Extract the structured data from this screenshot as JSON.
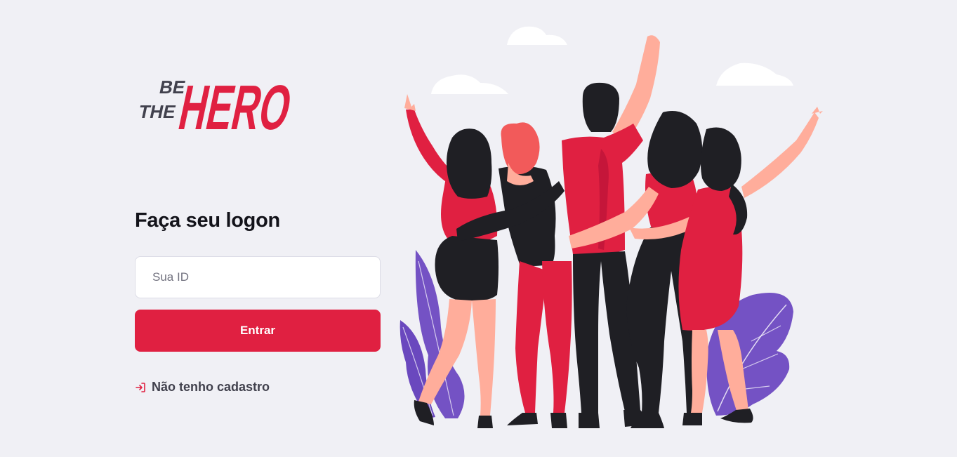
{
  "logo": {
    "top_word": "BE",
    "middle_word": "THE",
    "main_word": "HERO"
  },
  "form": {
    "title": "Faça seu logon",
    "id_placeholder": "Sua ID",
    "id_value": "",
    "submit_label": "Entrar",
    "register_label": "Não tenho cadastro"
  },
  "colors": {
    "background": "#f0f0f5",
    "accent": "#e02041",
    "text": "#13131a",
    "muted_text": "#41414d"
  },
  "icons": {
    "register_link": "log-in-icon"
  }
}
